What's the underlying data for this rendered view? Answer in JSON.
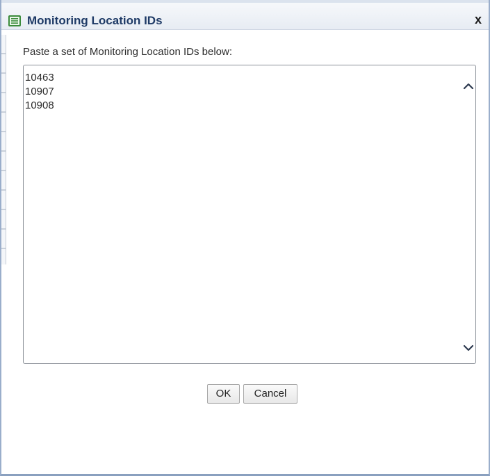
{
  "dialog": {
    "title": "Monitoring Location IDs",
    "title_icon": "list-icon",
    "close_label": "x"
  },
  "form": {
    "prompt": "Paste a set of Monitoring Location IDs below:",
    "ids_value": "10463\n10907\n10908"
  },
  "buttons": {
    "ok_label": "OK",
    "cancel_label": "Cancel"
  },
  "colors": {
    "title_text": "#1e3a66",
    "icon_green": "#3c8c3c",
    "frame_border": "#9aaecb"
  }
}
